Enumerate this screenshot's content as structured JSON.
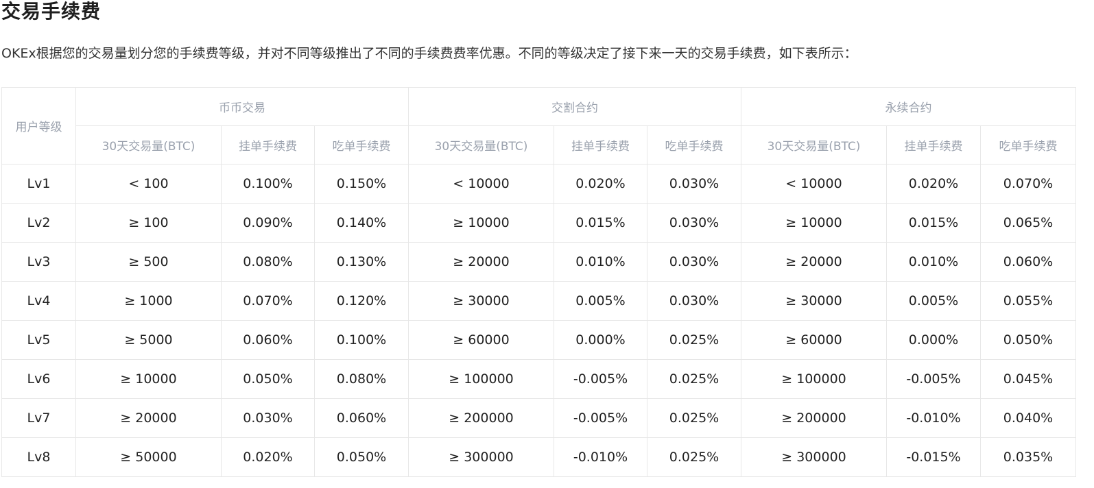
{
  "page": {
    "title": "交易手续费",
    "intro": "OKEx根据您的交易量划分您的手续费等级，并对不同等级推出了不同的手续费费率优惠。不同的等级决定了接下来一天的交易手续费，如下表所示："
  },
  "table": {
    "level_header": "用户等级",
    "groups": [
      {
        "label": "币币交易",
        "volume": "30天交易量(BTC)",
        "maker": "挂单手续费",
        "taker": "吃单手续费"
      },
      {
        "label": "交割合约",
        "volume": "30天交易量(BTC)",
        "maker": "挂单手续费",
        "taker": "吃单手续费"
      },
      {
        "label": "永续合约",
        "volume": "30天交易量(BTC)",
        "maker": "挂单手续费",
        "taker": "吃单手续费"
      }
    ],
    "rows": [
      [
        "Lv1",
        "< 100",
        "0.100%",
        "0.150%",
        "< 10000",
        "0.020%",
        "0.030%",
        "< 10000",
        "0.020%",
        "0.070%"
      ],
      [
        "Lv2",
        "≥ 100",
        "0.090%",
        "0.140%",
        "≥ 10000",
        "0.015%",
        "0.030%",
        "≥ 10000",
        "0.015%",
        "0.065%"
      ],
      [
        "Lv3",
        "≥ 500",
        "0.080%",
        "0.130%",
        "≥ 20000",
        "0.010%",
        "0.030%",
        "≥ 20000",
        "0.010%",
        "0.060%"
      ],
      [
        "Lv4",
        "≥ 1000",
        "0.070%",
        "0.120%",
        "≥ 30000",
        "0.005%",
        "0.030%",
        "≥ 30000",
        "0.005%",
        "0.055%"
      ],
      [
        "Lv5",
        "≥ 5000",
        "0.060%",
        "0.100%",
        "≥ 60000",
        "0.000%",
        "0.025%",
        "≥ 60000",
        "0.000%",
        "0.050%"
      ],
      [
        "Lv6",
        "≥ 10000",
        "0.050%",
        "0.080%",
        "≥ 100000",
        "-0.005%",
        "0.025%",
        "≥ 100000",
        "-0.005%",
        "0.045%"
      ],
      [
        "Lv7",
        "≥ 20000",
        "0.030%",
        "0.060%",
        "≥ 200000",
        "-0.005%",
        "0.025%",
        "≥ 200000",
        "-0.010%",
        "0.040%"
      ],
      [
        "Lv8",
        "≥ 50000",
        "0.020%",
        "0.050%",
        "≥ 300000",
        "-0.010%",
        "0.025%",
        "≥ 300000",
        "-0.015%",
        "0.035%"
      ]
    ]
  }
}
